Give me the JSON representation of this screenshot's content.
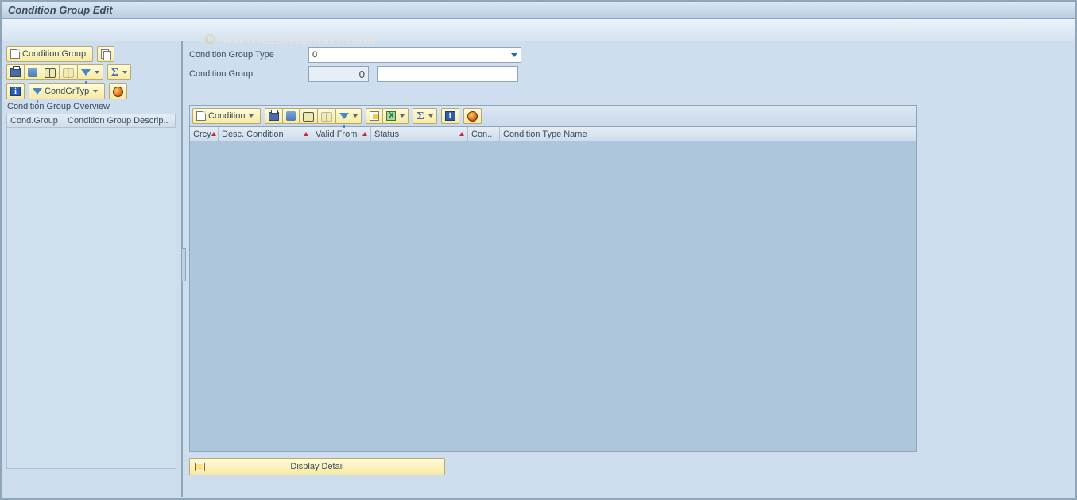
{
  "title": "Condition Group Edit",
  "watermark": "© www.tutorialkart.com",
  "sidebar": {
    "btn_condition_group": "Condition Group",
    "btn_condgrtyp": "CondGrTyp",
    "overview_title": "Condition Group Overview",
    "columns": [
      "Cond.Group",
      "Condition Group Descrip.."
    ]
  },
  "form": {
    "lbl_type": "Condition Group Type",
    "val_type": "0",
    "lbl_group": "Condition Group",
    "val_group": "0",
    "val_group_text": ""
  },
  "grid": {
    "btn_condition": "Condition",
    "columns": [
      "Crcy",
      "Desc. Condition",
      "Valid From",
      "Status",
      "Con..",
      "Condition Type Name"
    ]
  },
  "footer": {
    "display_detail": "Display Detail"
  }
}
